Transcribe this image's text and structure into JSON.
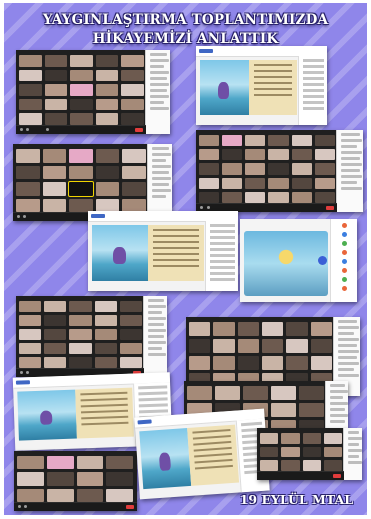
{
  "poster": {
    "title_line_1": "YAYGINLAŞTIRMA TOPLANTIMIZDA",
    "title_line_2": "HİKAYEMİZİ ANLATTIK",
    "school_label": "19 EYLÜL MTAL"
  },
  "colors": {
    "background": "#8f86ea",
    "meeting_dark": "#1f1f1f",
    "end_call_red": "#e03c3c",
    "story_page": "#efe1b6"
  },
  "screenshots": [
    {
      "kind": "video-meeting-grid"
    },
    {
      "kind": "storybook-with-participants"
    },
    {
      "kind": "video-meeting-grid"
    },
    {
      "kind": "video-meeting-grid"
    },
    {
      "kind": "storybook-with-participants"
    },
    {
      "kind": "storybook-illustration"
    },
    {
      "kind": "video-meeting-grid"
    },
    {
      "kind": "video-meeting-grid"
    },
    {
      "kind": "storybook-with-participants"
    },
    {
      "kind": "storybook-with-participants"
    },
    {
      "kind": "video-meeting-grid"
    },
    {
      "kind": "video-meeting-grid"
    },
    {
      "kind": "video-meeting-grid"
    }
  ]
}
